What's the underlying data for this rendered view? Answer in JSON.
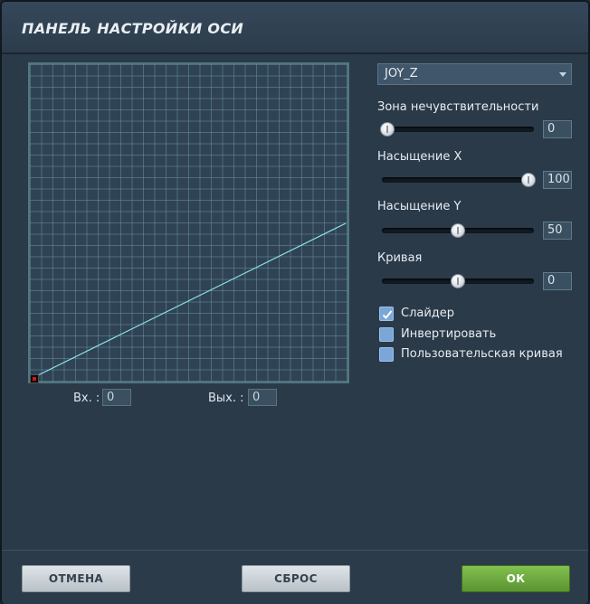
{
  "window": {
    "title": "ПАНЕЛЬ НАСТРОЙКИ ОСИ"
  },
  "graph": {
    "input_label": "Вх. :",
    "input_value": "0",
    "output_label": "Вых. :",
    "output_value": "0"
  },
  "axis_select": {
    "value": "JOY_Z"
  },
  "params": [
    {
      "label": "Зона нечувствительности",
      "value": "0",
      "fraction": 0.0
    },
    {
      "label": "Насыщение X",
      "value": "100",
      "fraction": 1.0
    },
    {
      "label": "Насыщение Y",
      "value": "50",
      "fraction": 0.5
    },
    {
      "label": "Кривая",
      "value": "0",
      "fraction": 0.5
    }
  ],
  "checkboxes": [
    {
      "label": "Слайдер",
      "checked": true
    },
    {
      "label": "Инвертировать",
      "checked": false
    },
    {
      "label": "Пользовательская кривая",
      "checked": false
    }
  ],
  "buttons": {
    "cancel": "ОТМЕНА",
    "reset": "СБРОС",
    "ok": "ОК"
  },
  "colors": {
    "curve": "#8fe3f0",
    "ok_green": "#6aa83c",
    "checkbox": "#7aa7d8"
  }
}
